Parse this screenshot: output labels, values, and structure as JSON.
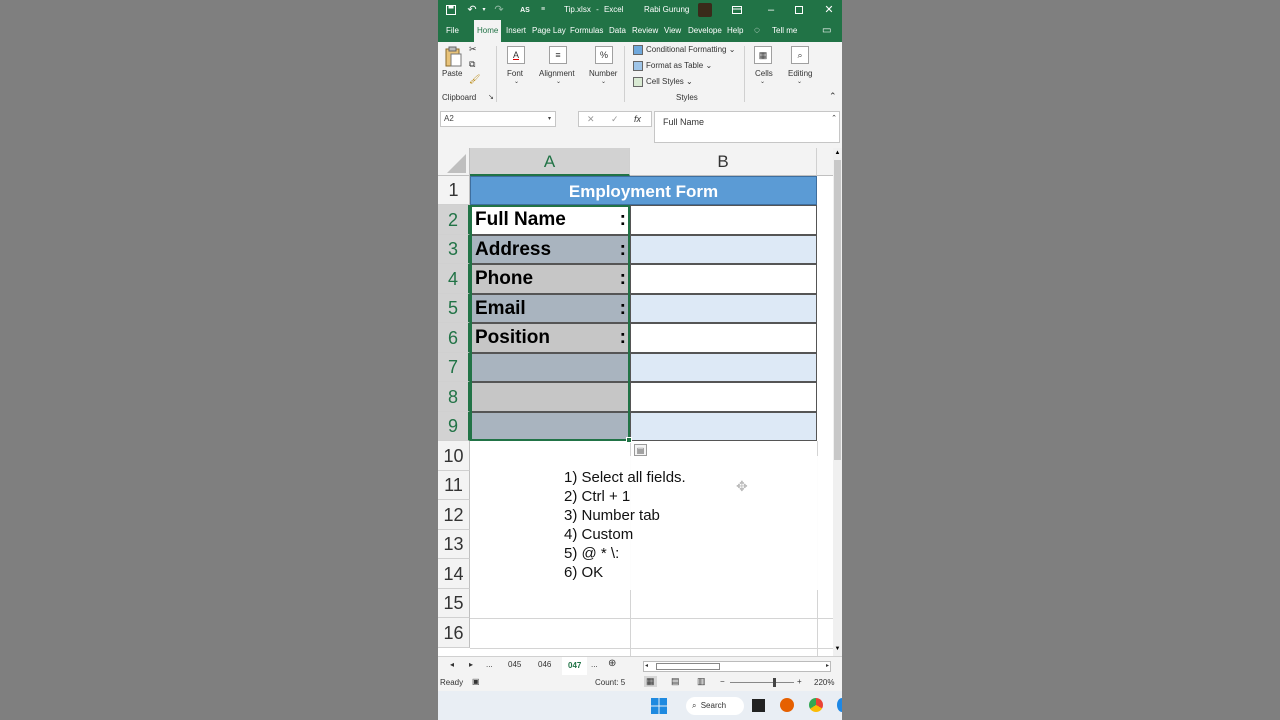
{
  "titlebar": {
    "filename": "Tip.xlsx",
    "separator": "-",
    "app": "Excel",
    "user": "Rabi Gurung",
    "autosave_label": "AS"
  },
  "ribbon_tabs": [
    "File",
    "Home",
    "Insert",
    "Page Lay",
    "Formulas",
    "Data",
    "Review",
    "View",
    "Develope",
    "Help"
  ],
  "tell_me": "Tell me",
  "ribbon": {
    "paste": "Paste",
    "clipboard": "Clipboard",
    "font": "Font",
    "alignment": "Alignment",
    "number": "Number",
    "conditional_formatting": "Conditional Formatting",
    "format_as_table": "Format as Table",
    "cell_styles": "Cell Styles",
    "styles": "Styles",
    "cells": "Cells",
    "editing": "Editing"
  },
  "formula_bar": {
    "name_box": "A2",
    "fx": "fx",
    "cancel": "✕",
    "enter": "✓",
    "content": "Full Name"
  },
  "columns": [
    "A",
    "B"
  ],
  "rows": [
    "1",
    "2",
    "3",
    "4",
    "5",
    "6",
    "7",
    "8",
    "9",
    "10",
    "11",
    "12",
    "13",
    "14",
    "15",
    "16"
  ],
  "form": {
    "title": "Employment Form",
    "fields": [
      "Full Name",
      "Address",
      "Phone",
      "Email",
      "Position"
    ],
    "colon": ":"
  },
  "instructions": [
    "1) Select all fields.",
    "2) Ctrl + 1",
    "3) Number tab",
    "4) Custom",
    "5) @ * \\:",
    "6) OK"
  ],
  "sheets": {
    "ellipsis": "...",
    "tabs": [
      "045",
      "046",
      "047"
    ],
    "active": "047"
  },
  "status": {
    "ready": "Ready",
    "count": "Count: 5",
    "zoom": "220%"
  },
  "taskbar": {
    "search": "Search"
  },
  "colors": {
    "excel_green": "#217346",
    "title_fill": "#5b9bd5",
    "label_fill": "#c9c9c9",
    "band_fill": "#dde9f6"
  }
}
